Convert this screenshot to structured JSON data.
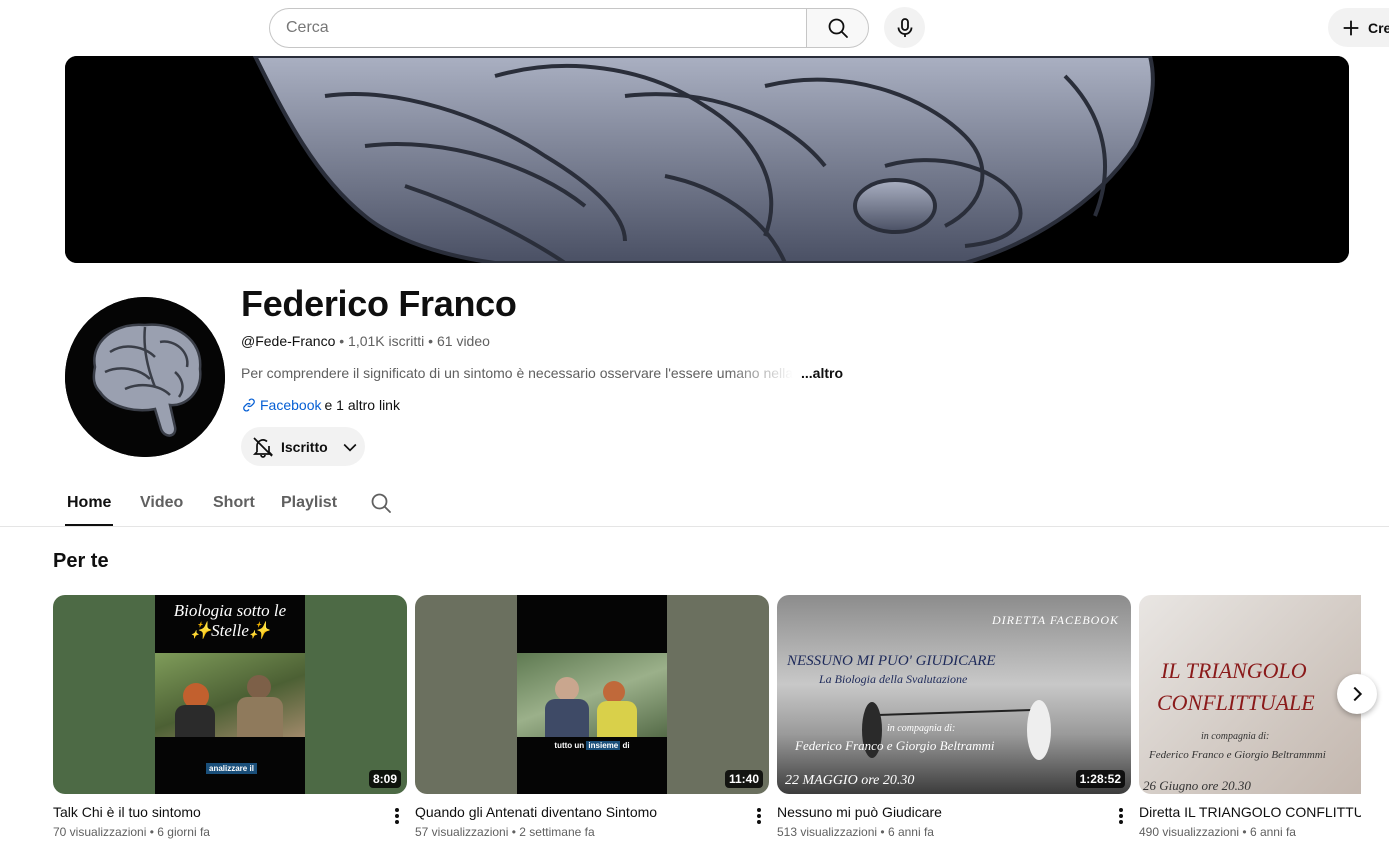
{
  "search": {
    "placeholder": "Cerca"
  },
  "header": {
    "create_label": "Cre"
  },
  "channel": {
    "name": "Federico Franco",
    "handle": "@Fede-Franco",
    "subscribers": "1,01K iscritti",
    "video_count": "61 video",
    "separator": " • ",
    "description": "Per comprendere il significato di un sintomo è necessario osservare l'essere umano nella",
    "more_label": "...altro",
    "link_main": "Facebook",
    "link_more": "e 1 altro link",
    "subscribe_label": "Iscritto"
  },
  "tabs": [
    {
      "label": "Home"
    },
    {
      "label": "Video"
    },
    {
      "label": "Short"
    },
    {
      "label": "Playlist"
    }
  ],
  "section": {
    "title": "Per te"
  },
  "videos": [
    {
      "title": "Talk Chi è il tuo sintomo",
      "views": "70 visualizzazioni",
      "age": "6 giorni fa",
      "duration": "8:09",
      "thumb_title": "Biologia sotto le ✨Stelle✨",
      "caption": "analizzare il"
    },
    {
      "title": "Quando gli Antenati diventano Sintomo",
      "views": "57 visualizzazioni",
      "age": "2 settimane fa",
      "duration": "11:40",
      "caption_a": "tutto un",
      "caption_b": "insieme",
      "caption_c": "di"
    },
    {
      "title": "Nessuno mi può Giudicare",
      "views": "513 visualizzazioni",
      "age": "6 anni fa",
      "duration": "1:28:52",
      "thumb_top": "DIRETTA FACEBOOK",
      "thumb_title": "NESSUNO MI PUO' GIUDICARE",
      "thumb_sub": "La Biologia della Svalutazione",
      "thumb_with": "in compagnia di:",
      "thumb_names": "Federico Franco e Giorgio Beltrammi",
      "thumb_date": "22 MAGGIO ore 20.30"
    },
    {
      "title": "Diretta  IL TRIANGOLO CONFLITTUALE",
      "views": "490 visualizzazioni",
      "age": "6 anni fa",
      "thumb_title_1": "IL TRIANGOLO",
      "thumb_title_2": "CONFLITTUALE",
      "thumb_with": "in compagnia di:",
      "thumb_names": "Federico Franco e Giorgio Beltrammmi",
      "thumb_date": "26 Giugno ore 20.30"
    }
  ],
  "colors": {
    "link": "#065fd4",
    "text": "#0f0f0f",
    "secondary": "#606060",
    "thumb1_bg": "#4d6a45",
    "thumb2_bg": "#6b705f"
  },
  "icons": [
    "search-icon",
    "mic-icon",
    "plus-icon",
    "link-icon",
    "bell-off-icon",
    "chevron-down-icon",
    "chevron-right-icon",
    "more-vert-icon"
  ]
}
